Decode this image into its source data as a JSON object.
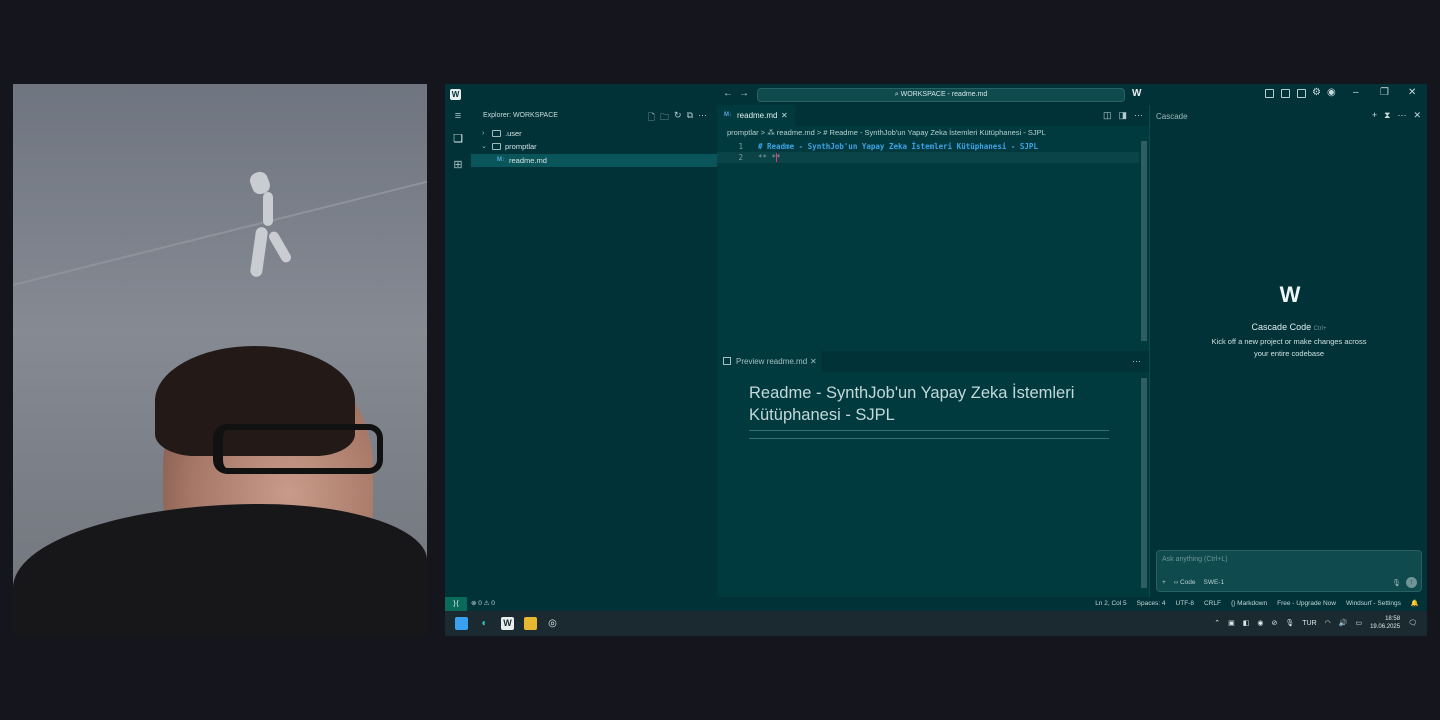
{
  "titlebar": {
    "search_text": "WORKSPACE - readme.md",
    "back_icon": "arrow-left-icon",
    "forward_icon": "arrow-right-icon"
  },
  "sidebar": {
    "title": "Explorer: WORKSPACE",
    "items": [
      {
        "label": ".user",
        "type": "folder",
        "expanded": false
      },
      {
        "label": "promptlar",
        "type": "folder",
        "expanded": true
      },
      {
        "label": "readme.md",
        "type": "file",
        "selected": true
      }
    ]
  },
  "editor": {
    "tab_label": "readme.md",
    "breadcrumb": "promptlar > ⁂ readme.md > # Readme - SynthJob'un Yapay Zeka İstemleri Kütüphanesi - SJPL",
    "lines": [
      {
        "number": "1",
        "text": "# Readme - SynthJob'un Yapay Zeka İstemleri Kütüphanesi - SJPL"
      },
      {
        "number": "2",
        "text": "**  **"
      }
    ]
  },
  "preview": {
    "tab_label": "Preview readme.md",
    "heading": "Readme - SynthJob'un Yapay Zeka İstemleri Kütüphanesi - SJPL"
  },
  "cascade": {
    "title": "Cascade",
    "heading": "Cascade Code",
    "shortcut": "Ctrl+",
    "subtitle": "Kick off a new project or make changes across your entire codebase",
    "input_placeholder": "Ask anything (Ctrl+L)",
    "mode_label": "Code",
    "model_label": "SWE-1"
  },
  "statusbar": {
    "problems": "⊗ 0 ⚠ 0",
    "position": "Ln 2, Col 5",
    "spaces": "Spaces: 4",
    "encoding": "UTF-8",
    "eol": "CRLF",
    "language": "Markdown",
    "plan": "Free - Upgrade Now",
    "settings": "Windsurf - Settings"
  },
  "taskbar": {
    "language": "TUR",
    "time": "18:58",
    "date": "19.06.2025"
  },
  "colors": {
    "editor_bg": "#003a3e",
    "sidebar_bg": "#003238",
    "heading_blue": "#3fa3e6",
    "cursor": "#ff3060"
  }
}
